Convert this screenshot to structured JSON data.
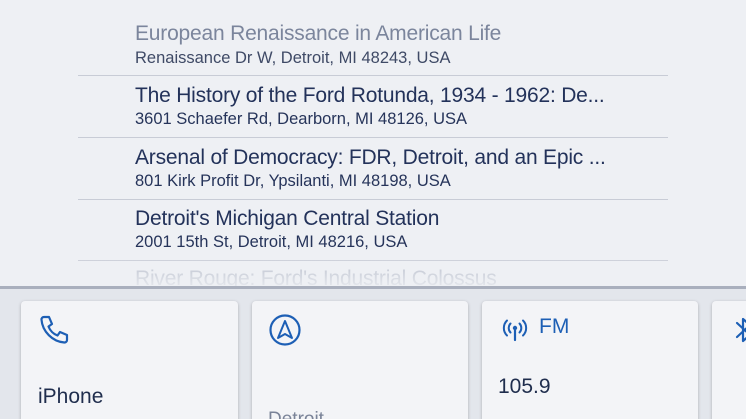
{
  "results": [
    {
      "title": "European Renaissance in American Life",
      "address": "Renaissance Dr W, Detroit, MI 48243, USA"
    },
    {
      "title": "The History of the Ford Rotunda, 1934 - 1962: De...",
      "address": "3601 Schaefer Rd, Dearborn, MI 48126, USA"
    },
    {
      "title": "Arsenal of Democracy: FDR, Detroit, and an Epic ...",
      "address": "801 Kirk Profit Dr, Ypsilanti, MI 48198, USA"
    },
    {
      "title": "Detroit's Michigan Central Station",
      "address": "2001 15th St, Detroit, MI 48216, USA"
    },
    {
      "title": "River Rouge: Ford's Industrial Colossus",
      "address": ""
    }
  ],
  "cards": {
    "phone": {
      "icon": "phone-icon",
      "label": "iPhone"
    },
    "navigation": {
      "icon": "navigation-arrow-icon",
      "label": "Detroit"
    },
    "radio": {
      "icon": "radio-signal-icon",
      "band": "FM",
      "frequency": "105.9"
    },
    "bluetooth": {
      "icon": "bluetooth-icon"
    }
  },
  "colors": {
    "accent": "#1d5fb5",
    "text": "#23325a",
    "panel_bg": "#eef0f4",
    "card_bg": "#f3f4f7"
  }
}
